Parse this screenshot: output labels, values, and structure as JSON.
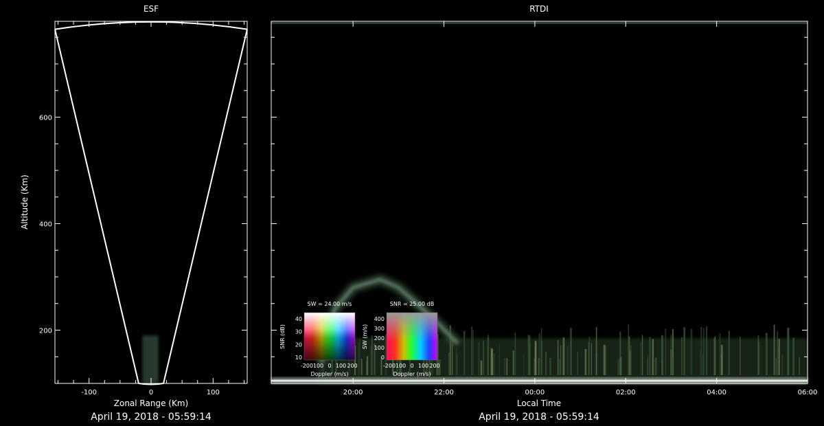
{
  "chart_data": [
    {
      "id": "esf",
      "type": "scatter",
      "title": "ESF",
      "xlabel": "Zonal Range (Km)",
      "ylabel": "Altitude (Km)",
      "xlim": [
        -155,
        155
      ],
      "ylim": [
        100,
        780
      ],
      "xticks": [
        -100,
        0,
        100
      ],
      "yticks": [
        200,
        400,
        600
      ],
      "fan": {
        "left_edge": [
          [
            -20,
            100
          ],
          [
            -155,
            765
          ]
        ],
        "right_edge": [
          [
            20,
            100
          ],
          [
            155,
            765
          ]
        ],
        "top_arc": {
          "left": [
            -155,
            765
          ],
          "apex": [
            0,
            780
          ],
          "right": [
            155,
            765
          ]
        }
      },
      "returns": {
        "x_range": [
          -14,
          12
        ],
        "y_range": [
          100,
          190
        ]
      },
      "footer": "April 19, 2018 - 05:59:14"
    },
    {
      "id": "rtdi",
      "type": "heatmap",
      "title": "RTDI",
      "xlabel": "Local Time",
      "xlim": [
        18.2,
        30.0
      ],
      "ylim": [
        100,
        780
      ],
      "xticks": [
        20,
        22,
        24,
        26,
        28,
        30
      ],
      "xticklabels": [
        "20:00",
        "22:00",
        "00:00",
        "02:00",
        "04:00",
        "06:00"
      ],
      "features": {
        "base_layer": {
          "alt": 105,
          "t_start": 18.2,
          "t_end": 30.0
        },
        "plume": [
          [
            19.3,
            140
          ],
          [
            19.6,
            240
          ],
          [
            20.0,
            280
          ],
          [
            20.6,
            295
          ],
          [
            21.0,
            280
          ],
          [
            21.4,
            250
          ],
          [
            21.9,
            210
          ],
          [
            22.3,
            175
          ]
        ],
        "band_top": 185
      },
      "footer": "April 19, 2018 - 05:59:14"
    }
  ],
  "legends": [
    {
      "id": "legend-sw",
      "title": "SW = 24.00 m/s",
      "ylabel": "SNR (dB)",
      "xlabel": "Doppler (m/s)",
      "yticks": [
        "40",
        "30",
        "20",
        "10"
      ],
      "xticks": [
        "-200",
        "100",
        "0",
        "100",
        "200"
      ]
    },
    {
      "id": "legend-snr",
      "title": "SNR = 25.00 dB",
      "ylabel": "SW (m/s)",
      "xlabel": "Doppler (m/s)",
      "yticks": [
        "400",
        "300",
        "200",
        "100",
        "0"
      ],
      "xticks": [
        "-200",
        "100",
        "0",
        "100",
        "200"
      ]
    }
  ]
}
